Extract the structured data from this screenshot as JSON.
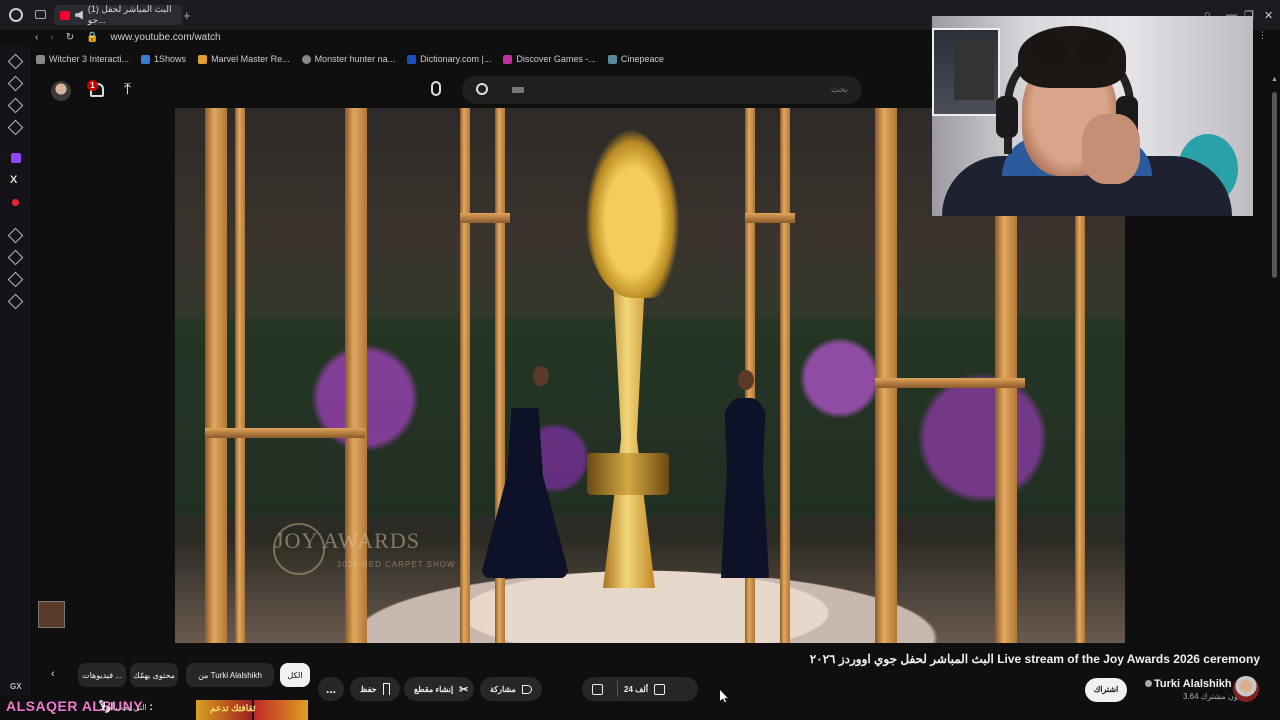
{
  "browser": {
    "tab_title": "(1) البث المباشر لحفل جو...",
    "url": "www.youtube.com/watch",
    "bookmarks": [
      "Witcher 3 Interacti...",
      "1Shows",
      "Marvel Master Re...",
      "Monster hunter na...",
      "Dictionary.com |...",
      "Discover Games -...",
      "Cinepeace"
    ]
  },
  "header": {
    "search_placeholder": "بحث",
    "notification_count": "1"
  },
  "video": {
    "watermark": "JOY AWARDS",
    "watermark_sub": "2026 RED CARPET SHOW"
  },
  "watch": {
    "title": "البث المباشر لحفل جوي اووردز ٢٠٢٦ Live stream of the Joy Awards 2026 ceremony",
    "channel_name": "Turki Alalshikh",
    "subscribers": "3.64 مليون مشترك",
    "subscribe_label": "اشتراك",
    "like_count": "24 ألف",
    "share_label": "مشاركة",
    "clip_label": "إنشاء مقطع",
    "save_label": "حفظ",
    "more_label": "..."
  },
  "chips": [
    {
      "label": "الكل",
      "active": true
    },
    {
      "label": "من Turki Alalshikh",
      "active": false
    },
    {
      "label": "محتوى يهمّك",
      "active": false
    },
    {
      "label": "فيديوهات ...",
      "active": false
    }
  ],
  "overlay": {
    "streamer_name": "ALSAQER ALBUNY",
    "strip_text": "اولاً :",
    "strip_caption": "التي يحب",
    "strip_img_text": "ثقافتك تدعم"
  },
  "colors": {
    "background": "#0f0f0f",
    "accent": "#ff0033",
    "overlay_name": "#f07ad0"
  }
}
